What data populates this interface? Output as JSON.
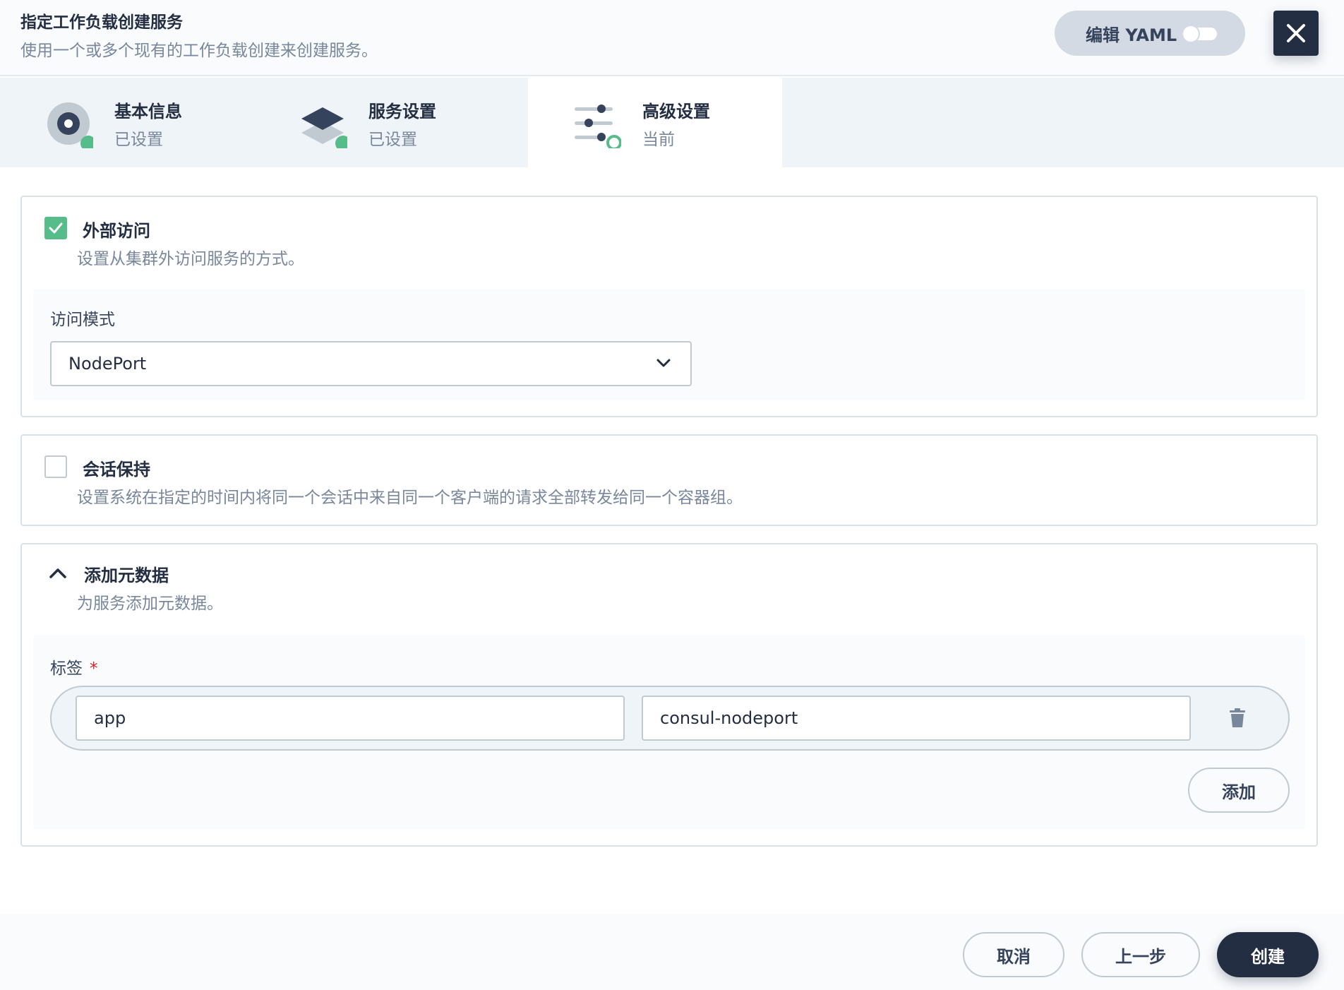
{
  "header": {
    "title": "指定工作负载创建服务",
    "subtitle": "使用一个或多个现有的工作负载创建来创建服务。",
    "edit_yaml_label": "编辑 YAML",
    "edit_yaml_enabled": false
  },
  "steps": [
    {
      "title": "基本信息",
      "status": "已设置",
      "icon": "basic-info-icon",
      "done": true
    },
    {
      "title": "服务设置",
      "status": "已设置",
      "icon": "layers-icon",
      "done": true
    },
    {
      "title": "高级设置",
      "status": "当前",
      "icon": "sliders-icon",
      "done": false,
      "active": true
    }
  ],
  "external_access": {
    "checked": true,
    "title": "外部访问",
    "description": "设置从集群外访问服务的方式。",
    "mode_label": "访问模式",
    "mode_value": "NodePort"
  },
  "session_affinity": {
    "checked": false,
    "title": "会话保持",
    "description": "设置系统在指定的时间内将同一个会话中来自同一个客户端的请求全部转发给同一个容器组。"
  },
  "metadata": {
    "title": "添加元数据",
    "description": "为服务添加元数据。",
    "labels_label": "标签",
    "required_mark": "*",
    "labels": [
      {
        "key": "app",
        "value": "consul-nodeport"
      }
    ],
    "add_label": "添加"
  },
  "footer": {
    "cancel_label": "取消",
    "prev_label": "上一步",
    "create_label": "创建"
  },
  "colors": {
    "primary_dark": "#242e42",
    "success": "#55bc8a",
    "muted_text": "#79879c",
    "required": "#ca2621"
  }
}
